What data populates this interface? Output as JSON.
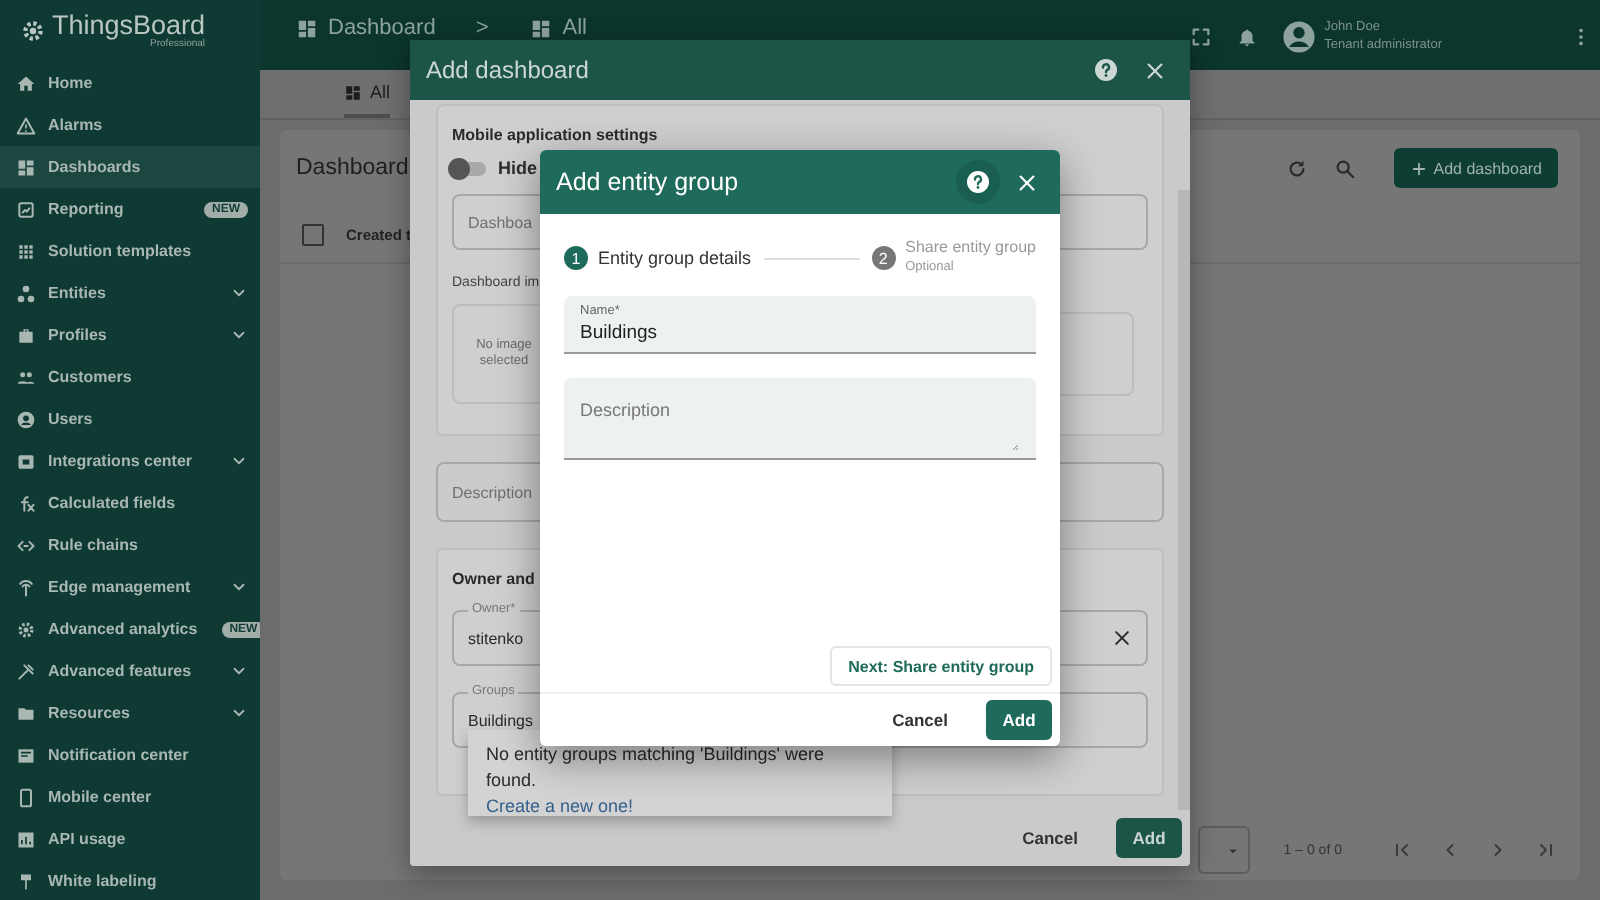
{
  "app": {
    "logo_text": "ThingsBoard",
    "logo_subtext": "Professional"
  },
  "sidebar": {
    "items": [
      {
        "label": "Home",
        "selected": false,
        "expandable": false
      },
      {
        "label": "Alarms",
        "selected": false,
        "expandable": false
      },
      {
        "label": "Dashboards",
        "selected": true,
        "expandable": false
      },
      {
        "label": "Reporting",
        "selected": false,
        "expandable": false,
        "badge": "NEW"
      },
      {
        "label": "Solution templates",
        "selected": false,
        "expandable": false
      },
      {
        "label": "Entities",
        "selected": false,
        "expandable": true
      },
      {
        "label": "Profiles",
        "selected": false,
        "expandable": true
      },
      {
        "label": "Customers",
        "selected": false,
        "expandable": false
      },
      {
        "label": "Users",
        "selected": false,
        "expandable": false
      },
      {
        "label": "Integrations center",
        "selected": false,
        "expandable": true
      },
      {
        "label": "Calculated fields",
        "selected": false,
        "expandable": false
      },
      {
        "label": "Rule chains",
        "selected": false,
        "expandable": false
      },
      {
        "label": "Edge management",
        "selected": false,
        "expandable": true
      },
      {
        "label": "Advanced analytics",
        "selected": false,
        "expandable": false,
        "badge": "NEW"
      },
      {
        "label": "Advanced features",
        "selected": false,
        "expandable": true
      },
      {
        "label": "Resources",
        "selected": false,
        "expandable": true
      },
      {
        "label": "Notification center",
        "selected": false,
        "expandable": false
      },
      {
        "label": "Mobile center",
        "selected": false,
        "expandable": false
      },
      {
        "label": "API usage",
        "selected": false,
        "expandable": false
      },
      {
        "label": "White labeling",
        "selected": false,
        "expandable": false
      }
    ]
  },
  "top_bar": {
    "breadcrumb": [
      {
        "label": "Dashboard"
      },
      {
        "label": "All"
      }
    ],
    "separator": ">",
    "user": {
      "name": "John Doe",
      "role": "Tenant administrator"
    }
  },
  "tabs": [
    {
      "label": "All",
      "selected": true
    }
  ],
  "list": {
    "title": "Dashboard",
    "add_button": "Add dashboard",
    "columns": [
      {
        "label": "Created t"
      }
    ],
    "select_all": {
      "checked": false
    },
    "paginator": {
      "range": "1 – 0 of 0"
    }
  },
  "add_dashboard_dialog": {
    "title": "Add dashboard",
    "mobile_section": {
      "title": "Mobile application settings",
      "toggle": {
        "label": "Hide",
        "on": false
      },
      "field": {
        "placeholder": "Dashboa"
      },
      "image_label": "Dashboard im",
      "image_placeholder": "No image selected"
    },
    "description": {
      "placeholder": "Description"
    },
    "owner_section": {
      "title": "Owner and",
      "owner": {
        "label": "Owner*",
        "value": "stitenko"
      },
      "groups": {
        "label": "Groups",
        "value": "Buildings"
      }
    },
    "autocomplete": {
      "message": "No entity groups matching 'Buildings' were found.",
      "link": "Create a new one!"
    },
    "cancel": "Cancel",
    "add": "Add"
  },
  "add_entity_group_dialog": {
    "title": "Add entity group",
    "steps": [
      {
        "number": "1",
        "label": "Entity group details",
        "selected": true
      },
      {
        "number": "2",
        "label": "Share entity group",
        "sublabel": "Optional",
        "selected": false
      }
    ],
    "name": {
      "label": "Name*",
      "value": "Buildings"
    },
    "description": {
      "placeholder": "Description"
    },
    "next": "Next: Share entity group",
    "cancel": "Cancel",
    "add": "Add"
  }
}
